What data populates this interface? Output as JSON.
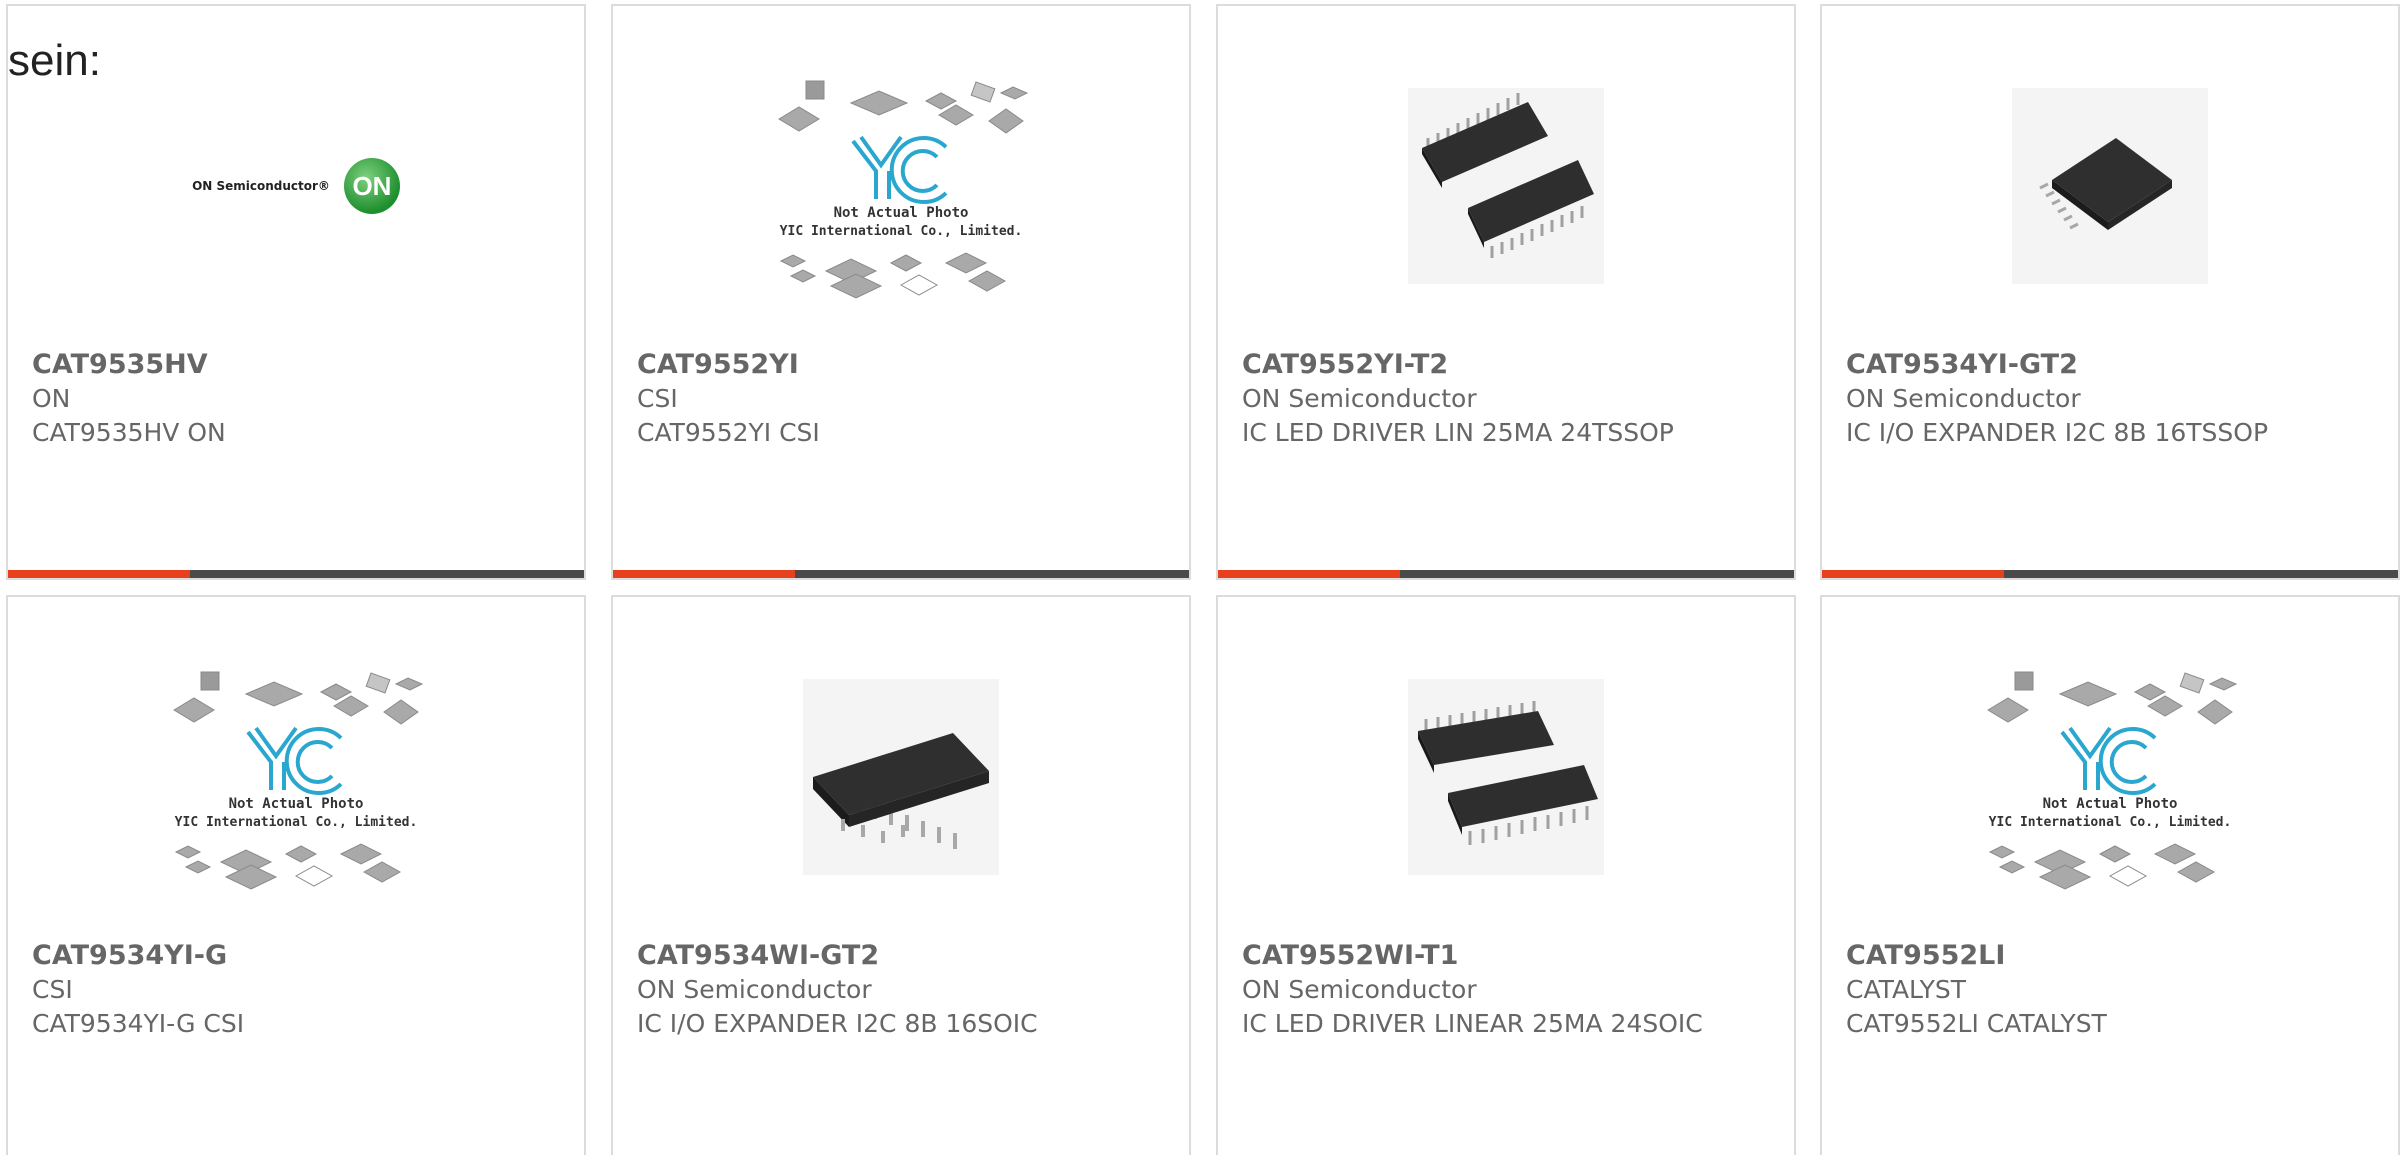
{
  "intro_text": "sein:",
  "accent_color": "#e8401c",
  "bar_color": "#4a4a4a",
  "placeholder_image": {
    "line1": "Not Actual Photo",
    "line2": "YIC International Co., Limited."
  },
  "cards": [
    {
      "part": "CAT9535HV",
      "maker": "ON",
      "desc": "CAT9535HV ON",
      "image": "on-semiconductor-logo",
      "logo_text": "ON Semiconductor®",
      "logo_mark": "ON"
    },
    {
      "part": "CAT9552YI",
      "maker": "CSI",
      "desc": "CAT9552YI CSI",
      "image": "yic-placeholder"
    },
    {
      "part": "CAT9552YI-T2",
      "maker": "ON Semiconductor",
      "desc": "IC LED DRIVER LIN 25MA 24TSSOP",
      "image": "tssop-chip-photo"
    },
    {
      "part": "CAT9534YI-GT2",
      "maker": "ON Semiconductor",
      "desc": "IC I/O EXPANDER I2C 8B 16TSSOP",
      "image": "tssop16-chip-photo"
    },
    {
      "part": "CAT9534YI-G",
      "maker": "CSI",
      "desc": "CAT9534YI-G CSI",
      "image": "yic-placeholder"
    },
    {
      "part": "CAT9534WI-GT2",
      "maker": "ON Semiconductor",
      "desc": "IC I/O EXPANDER I2C 8B 16SOIC",
      "image": "soic16-chip-photo"
    },
    {
      "part": "CAT9552WI-T1",
      "maker": "ON Semiconductor",
      "desc": "IC LED DRIVER LINEAR 25MA 24SOIC",
      "image": "soic24-chip-photo"
    },
    {
      "part": "CAT9552LI",
      "maker": "CATALYST",
      "desc": "CAT9552LI CATALYST",
      "image": "yic-placeholder"
    }
  ]
}
